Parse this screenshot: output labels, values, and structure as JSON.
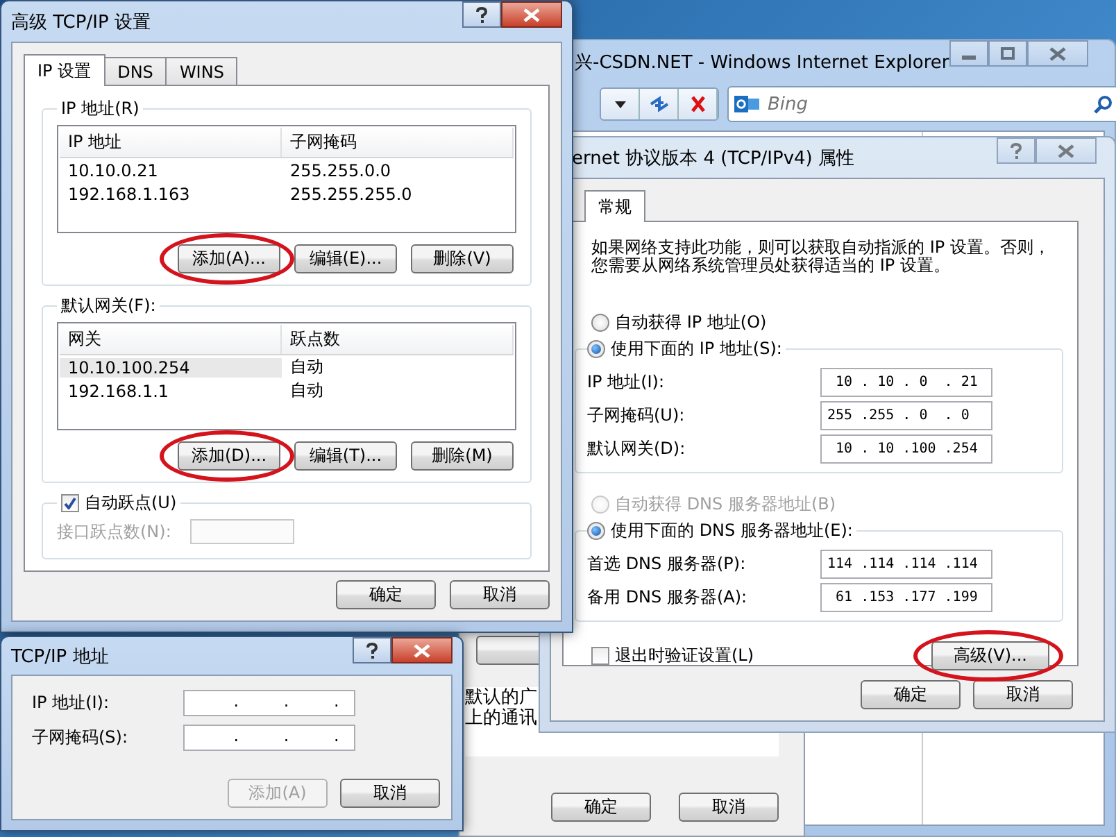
{
  "ie_window": {
    "title": "兴-CSDN.NET - Windows Internet Explorer",
    "search": {
      "placeholder": "Bing"
    }
  },
  "background_dialog": {
    "texts": [
      "默认的广",
      "上的通讯"
    ],
    "buttons": [
      "确定",
      "取消"
    ]
  },
  "ipv4_properties": {
    "title": "ernet 协议版本 4 (TCP/IPv4) 属性",
    "tabs": [
      {
        "label": "常规",
        "selected": true
      }
    ],
    "description_lines": [
      "如果网络支持此功能，则可以获取自动指派的 IP 设置。否则，",
      "您需要从网络系统管理员处获得适当的 IP 设置。"
    ],
    "ip_options": [
      {
        "label": "自动获得 IP 地址(O)",
        "selected": false,
        "disabled": false
      },
      {
        "label": "使用下面的 IP 地址(S):",
        "selected": true,
        "disabled": false
      }
    ],
    "ip_fields": [
      {
        "label": "IP 地址(I):",
        "value": " 10 . 10 . 0  . 21"
      },
      {
        "label": "子网掩码(U):",
        "value": "255 .255 . 0  . 0"
      },
      {
        "label": "默认网关(D):",
        "value": " 10 . 10 .100 .254"
      }
    ],
    "dns_options": [
      {
        "label": "自动获得 DNS 服务器地址(B)",
        "selected": false,
        "disabled": true
      },
      {
        "label": "使用下面的 DNS 服务器地址(E):",
        "selected": true,
        "disabled": false
      }
    ],
    "dns_fields": [
      {
        "label": "首选 DNS 服务器(P):",
        "value": "114 .114 .114 .114"
      },
      {
        "label": "备用 DNS 服务器(A):",
        "value": " 61 .153 .177 .199"
      }
    ],
    "validate_checkbox": {
      "label": "退出时验证设置(L)",
      "checked": false
    },
    "advanced_button": {
      "label": "高级(V)...",
      "highlighted": true
    },
    "buttons": [
      "确定",
      "取消"
    ]
  },
  "advanced_tcpip": {
    "title": "高级 TCP/IP 设置",
    "tabs": [
      {
        "label": "IP 设置",
        "selected": true
      },
      {
        "label": "DNS",
        "selected": false
      },
      {
        "label": "WINS",
        "selected": false
      }
    ],
    "ip_group": {
      "title": "IP 地址(R)",
      "columns": [
        "IP 地址",
        "子网掩码"
      ],
      "rows": [
        {
          "cells": [
            "10.10.0.21",
            "255.255.0.0"
          ],
          "selected": false
        },
        {
          "cells": [
            "192.168.1.163",
            "255.255.255.0"
          ],
          "selected": false
        }
      ],
      "buttons": [
        {
          "label": "添加(A)...",
          "highlighted": true
        },
        {
          "label": "编辑(E)...",
          "highlighted": false
        },
        {
          "label": "删除(V)",
          "highlighted": false
        }
      ]
    },
    "gateway_group": {
      "title": "默认网关(F):",
      "columns": [
        "网关",
        "跃点数"
      ],
      "rows": [
        {
          "cells": [
            "10.10.100.254",
            "自动"
          ],
          "selected": true
        },
        {
          "cells": [
            "192.168.1.1",
            "自动"
          ],
          "selected": false
        }
      ],
      "buttons": [
        {
          "label": "添加(D)...",
          "highlighted": true
        },
        {
          "label": "编辑(T)...",
          "highlighted": false
        },
        {
          "label": "删除(M)",
          "highlighted": false
        }
      ]
    },
    "auto_metric": {
      "label": "自动跃点(U)",
      "checked": true
    },
    "interface_metric": {
      "label": "接口跃点数(N):",
      "disabled": true
    },
    "buttons": [
      "确定",
      "取消"
    ]
  },
  "tcpip_address": {
    "title": "TCP/IP 地址",
    "fields": [
      {
        "label": "IP 地址(I):",
        "value": "     .     .     ."
      },
      {
        "label": "子网掩码(S):",
        "value": "     .     .     ."
      }
    ],
    "buttons": [
      {
        "label": "添加(A)",
        "disabled": true
      },
      {
        "label": "取消",
        "disabled": false
      }
    ]
  }
}
